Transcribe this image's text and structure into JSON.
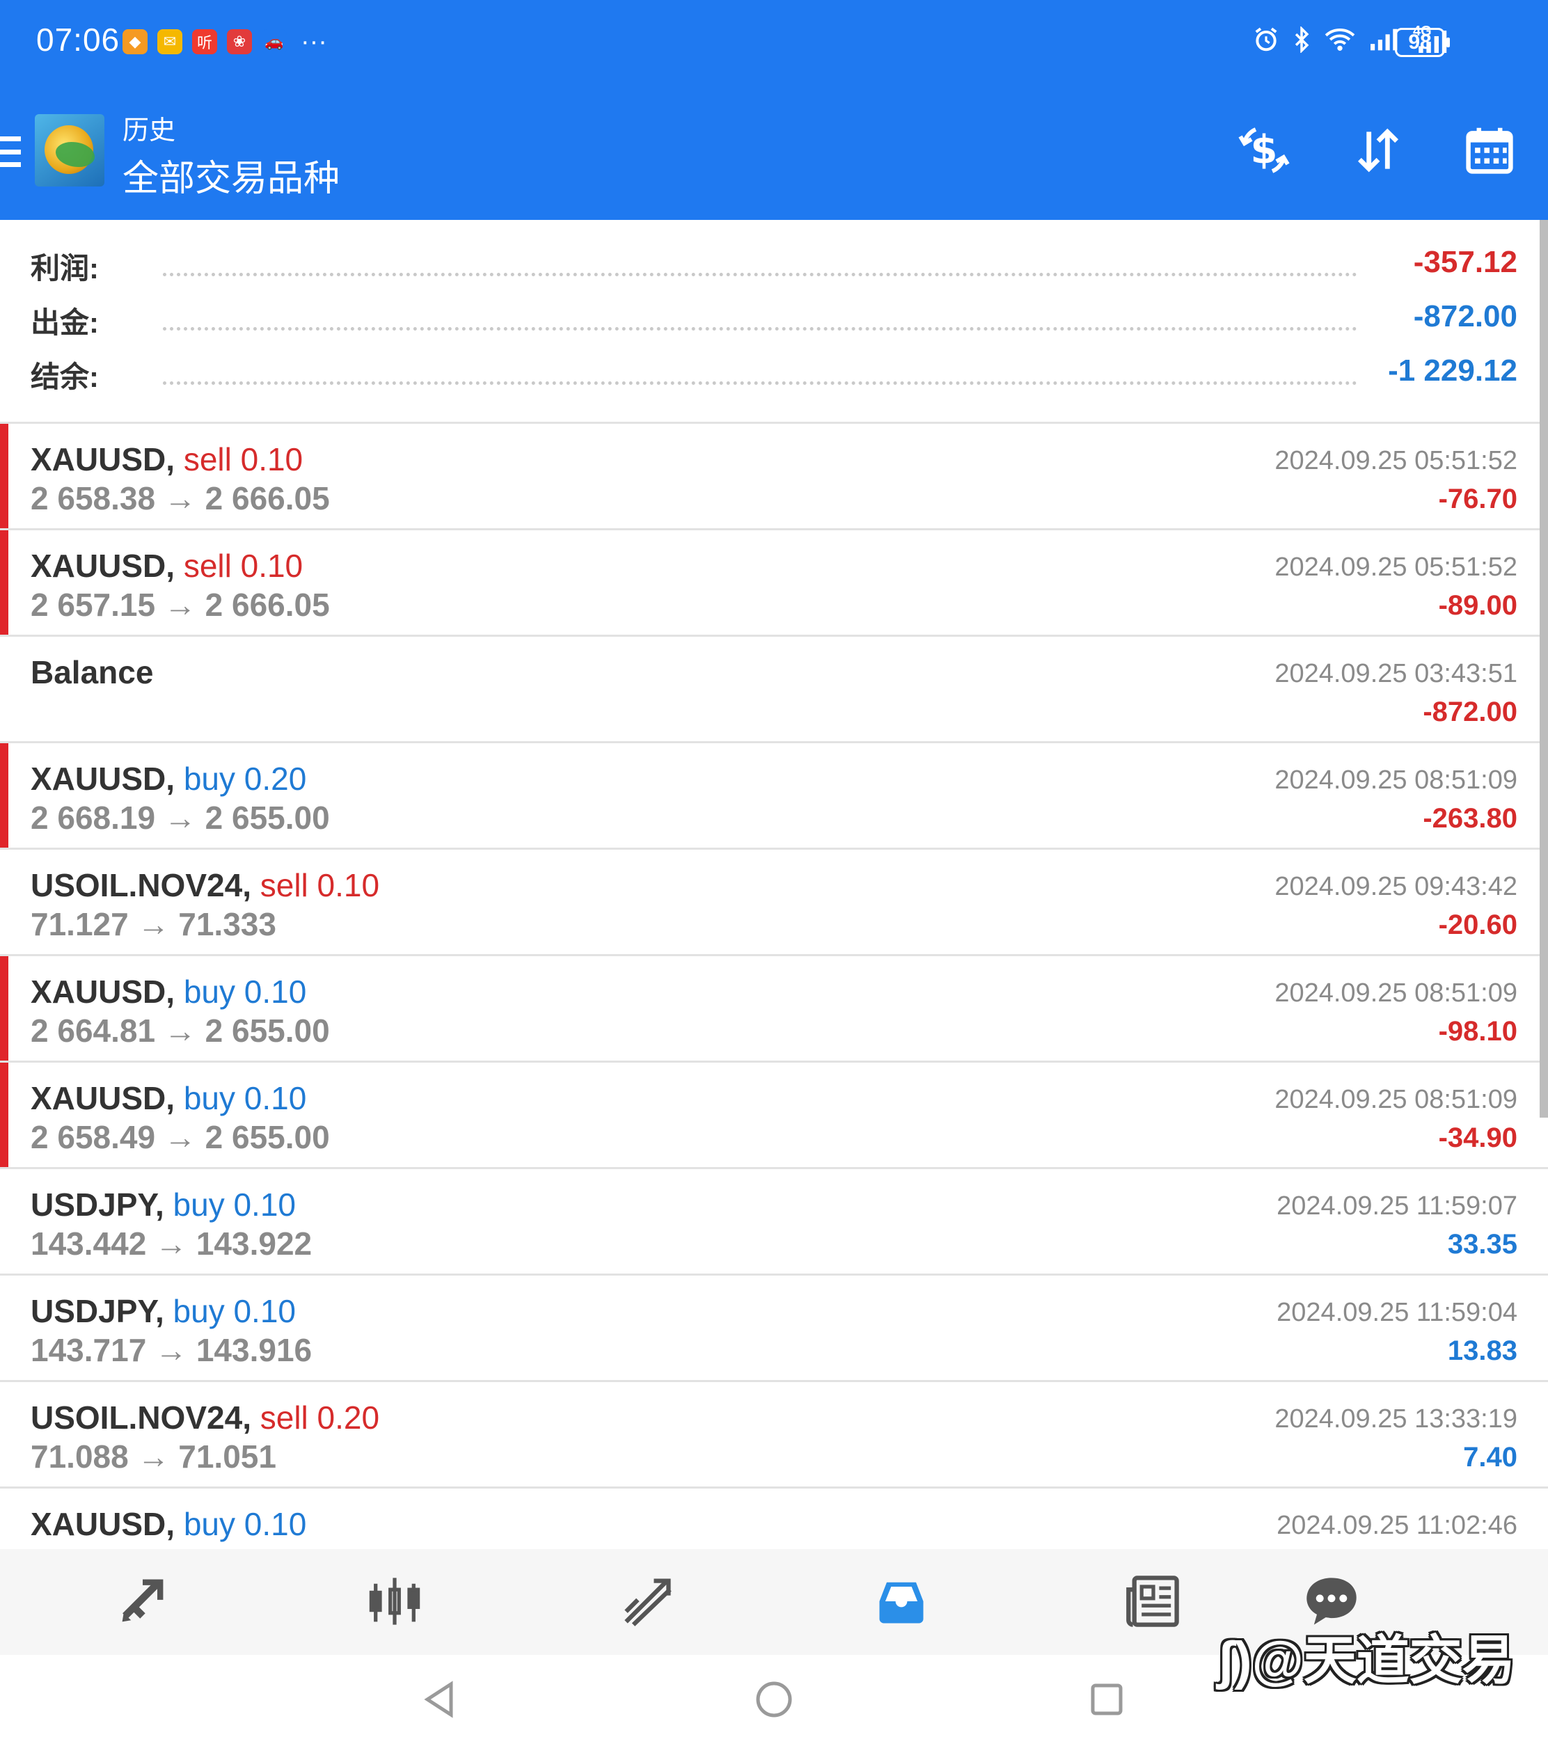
{
  "status_bar": {
    "time": "07:06",
    "notifications": [
      {
        "icon": "app-orange-icon",
        "color": "#f59a23",
        "glyph": "◆"
      },
      {
        "icon": "mail-icon",
        "color": "#f5b800",
        "glyph": "✉"
      },
      {
        "icon": "listen-app-icon",
        "color": "#ef3a2f",
        "glyph": "听"
      },
      {
        "icon": "app-red-icon",
        "color": "#e23b3b",
        "glyph": "❀"
      },
      {
        "icon": "app-car-icon",
        "color": "#1f79f0",
        "glyph": "🚗"
      }
    ],
    "more": "···",
    "network": "4G",
    "battery": "98"
  },
  "header": {
    "title_top": "历史",
    "title_main": "全部交易品种"
  },
  "summary": [
    {
      "label": "利润:",
      "value": "-357.12",
      "color": "red"
    },
    {
      "label": "出金:",
      "value": "-872.00",
      "color": "blue"
    },
    {
      "label": "结余:",
      "value": "-1 229.12",
      "color": "blue"
    }
  ],
  "deals": [
    {
      "symbol": "XAUUSD,",
      "type": "sell 0.10",
      "type_color": "red",
      "prices": "2 658.38 → 2 666.05",
      "datetime": "2024.09.25 05:51:52",
      "profit": "-76.70",
      "profit_color": "red",
      "marker": true
    },
    {
      "symbol": "XAUUSD,",
      "type": "sell 0.10",
      "type_color": "red",
      "prices": "2 657.15 → 2 666.05",
      "datetime": "2024.09.25 05:51:52",
      "profit": "-89.00",
      "profit_color": "red",
      "marker": true
    },
    {
      "symbol": "Balance",
      "type": "",
      "type_color": "red",
      "prices": "",
      "datetime": "2024.09.25 03:43:51",
      "profit": "-872.00",
      "profit_color": "red",
      "marker": false
    },
    {
      "symbol": "XAUUSD,",
      "type": "buy 0.20",
      "type_color": "blue",
      "prices": "2 668.19 → 2 655.00",
      "datetime": "2024.09.25 08:51:09",
      "profit": "-263.80",
      "profit_color": "red",
      "marker": true
    },
    {
      "symbol": "USOIL.NOV24,",
      "type": "sell 0.10",
      "type_color": "red",
      "prices": "71.127 → 71.333",
      "datetime": "2024.09.25 09:43:42",
      "profit": "-20.60",
      "profit_color": "red",
      "marker": false
    },
    {
      "symbol": "XAUUSD,",
      "type": "buy 0.10",
      "type_color": "blue",
      "prices": "2 664.81 → 2 655.00",
      "datetime": "2024.09.25 08:51:09",
      "profit": "-98.10",
      "profit_color": "red",
      "marker": true
    },
    {
      "symbol": "XAUUSD,",
      "type": "buy 0.10",
      "type_color": "blue",
      "prices": "2 658.49 → 2 655.00",
      "datetime": "2024.09.25 08:51:09",
      "profit": "-34.90",
      "profit_color": "red",
      "marker": true
    },
    {
      "symbol": "USDJPY,",
      "type": "buy 0.10",
      "type_color": "blue",
      "prices": "143.442 → 143.922",
      "datetime": "2024.09.25 11:59:07",
      "profit": "33.35",
      "profit_color": "blue",
      "marker": false
    },
    {
      "symbol": "USDJPY,",
      "type": "buy 0.10",
      "type_color": "blue",
      "prices": "143.717 → 143.916",
      "datetime": "2024.09.25 11:59:04",
      "profit": "13.83",
      "profit_color": "blue",
      "marker": false
    },
    {
      "symbol": "USOIL.NOV24,",
      "type": "sell 0.20",
      "type_color": "red",
      "prices": "71.088 → 71.051",
      "datetime": "2024.09.25 13:33:19",
      "profit": "7.40",
      "profit_color": "blue",
      "marker": false
    },
    {
      "symbol": "XAUUSD,",
      "type": "buy 0.10",
      "type_color": "blue",
      "prices": "",
      "datetime": "2024.09.25 11:02:46",
      "profit": "",
      "profit_color": "blue",
      "marker": false
    }
  ],
  "bottom_nav": [
    {
      "name": "quotes",
      "icon": "quotes-arrows-icon",
      "active": false
    },
    {
      "name": "chart",
      "icon": "candlestick-chart-icon",
      "active": false
    },
    {
      "name": "trade",
      "icon": "trade-chart-icon",
      "active": false
    },
    {
      "name": "history",
      "icon": "history-inbox-icon",
      "active": true
    },
    {
      "name": "news",
      "icon": "news-icon",
      "active": false
    },
    {
      "name": "messages",
      "icon": "chat-bubble-icon",
      "active": false
    }
  ],
  "watermark": "@天道交易",
  "colors": {
    "header": "#1f79f0",
    "loss": "#d62b2b",
    "profit": "#1f7ad4",
    "marker": "#e0252b",
    "active_nav": "#2b8fe8"
  }
}
